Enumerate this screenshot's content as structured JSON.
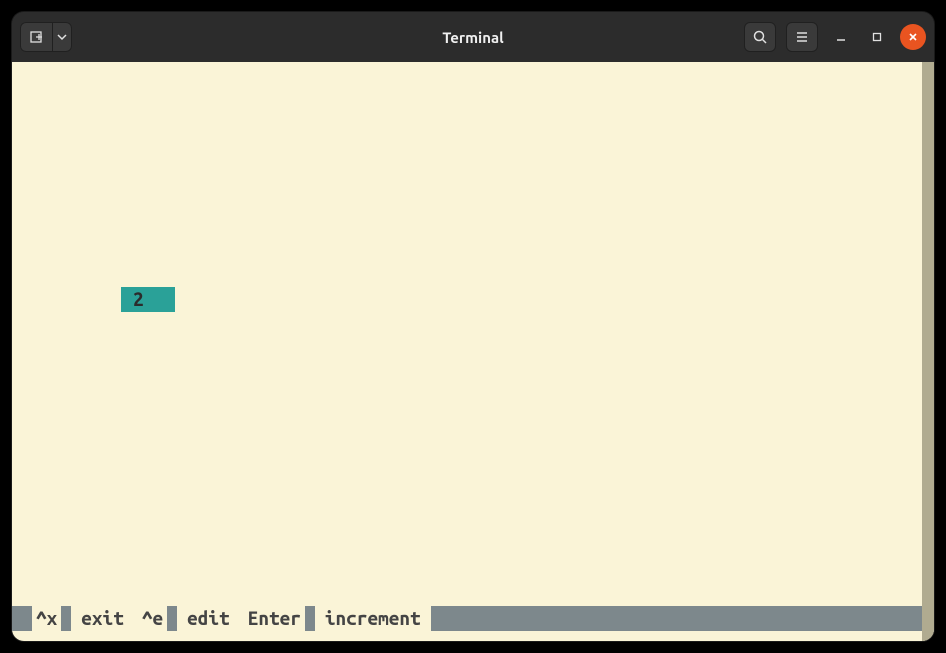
{
  "window": {
    "title": "Terminal"
  },
  "content": {
    "value": "2"
  },
  "footer": {
    "items": [
      {
        "key": "^x",
        "label": "exit"
      },
      {
        "key": "^e",
        "label": "edit"
      },
      {
        "key": "Enter",
        "label": "increment"
      }
    ]
  }
}
